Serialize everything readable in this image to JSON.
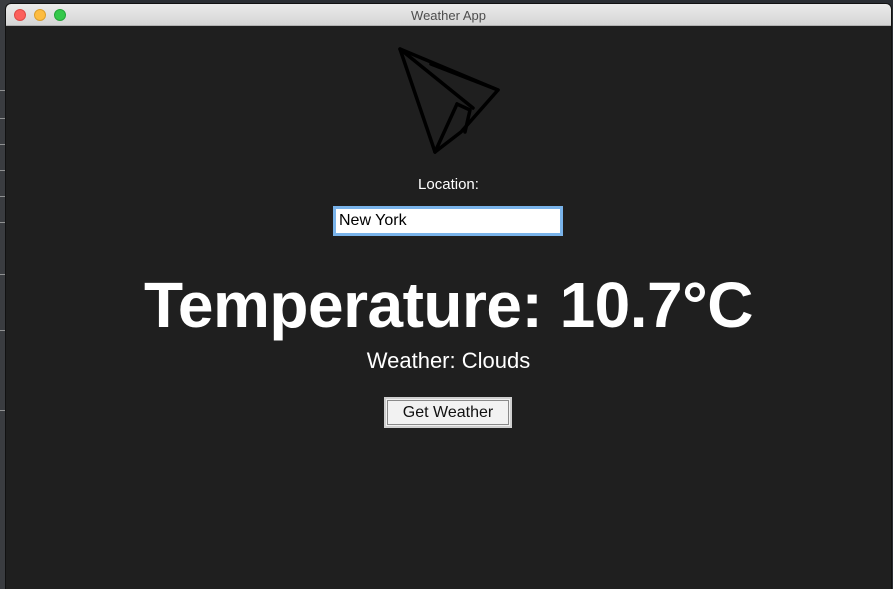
{
  "window": {
    "title": "Weather App"
  },
  "logo": {
    "icon": "paper-plane-icon"
  },
  "form": {
    "location_label": "Location:",
    "location_value": "New York"
  },
  "result": {
    "temperature_text": "Temperature: 10.7°C",
    "weather_text": "Weather: Clouds"
  },
  "actions": {
    "get_weather_label": "Get Weather"
  },
  "colors": {
    "window_bg": "#1f1f1f",
    "text": "#ffffff",
    "input_focus_border": "#79b3ea",
    "close": "#fc605c",
    "minimize": "#fdbc40",
    "maximize": "#34c84a"
  }
}
